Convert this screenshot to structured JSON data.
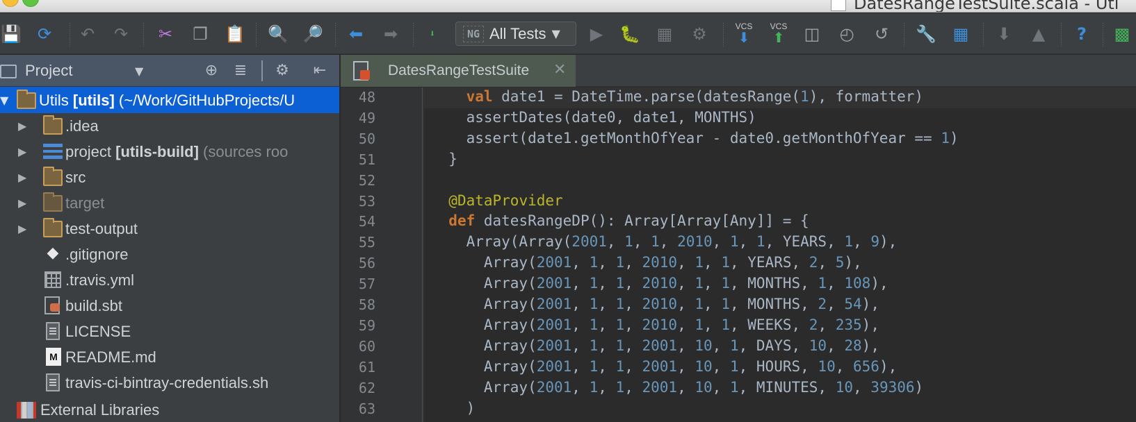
{
  "window": {
    "title": "DatesRangeTestSuite.scala - Uti"
  },
  "toolbar": {
    "run_config": "All Tests",
    "run_config_icon": "NG",
    "vcs_update_label": "VCS",
    "vcs_commit_label": "VCS",
    "icons": [
      "save-icon",
      "sync-icon",
      "undo-icon",
      "redo-icon",
      "cut-icon",
      "copy-icon",
      "paste-icon",
      "find-icon",
      "replace-icon",
      "back-icon",
      "forward-icon",
      "make-icon",
      "run-icon",
      "debug-icon",
      "coverage-icon",
      "profile-icon",
      "vcs-update-icon",
      "vcs-commit-icon",
      "compare-icon",
      "history-icon",
      "revert-icon",
      "settings-icon",
      "structure-icon",
      "sdk-icon",
      "android-icon",
      "help-icon",
      "tool-icon"
    ]
  },
  "project_panel": {
    "title": "Project",
    "items": [
      {
        "label": "Utils",
        "module": "[utils]",
        "path": "(~/Work/GitHubProjects/U",
        "type": "folder",
        "expanded": true,
        "selected": true
      },
      {
        "label": ".idea",
        "type": "folder"
      },
      {
        "label": "project",
        "module": "[utils-build]",
        "hint": "(sources roo",
        "type": "module"
      },
      {
        "label": "src",
        "type": "folder"
      },
      {
        "label": "target",
        "type": "folder-excluded"
      },
      {
        "label": "test-output",
        "type": "folder"
      },
      {
        "label": ".gitignore",
        "type": "git-file"
      },
      {
        "label": ".travis.yml",
        "type": "yml-file"
      },
      {
        "label": "build.sbt",
        "type": "sbt-file"
      },
      {
        "label": "LICENSE",
        "type": "text-file"
      },
      {
        "label": "README.md",
        "type": "md-file"
      },
      {
        "label": "travis-ci-bintray-credentials.sh",
        "type": "text-file"
      },
      {
        "label": "External Libraries",
        "type": "libraries"
      }
    ]
  },
  "editor": {
    "tab_label": "DatesRangeTestSuite",
    "lines": [
      {
        "n": "48",
        "text": "    val date1 = DateTime.parse(datesRange(1), formatter)"
      },
      {
        "n": "49",
        "text": "    assertDates(date0, date1, MONTHS)"
      },
      {
        "n": "50",
        "text": "    assert(date1.getMonthOfYear - date0.getMonthOfYear == 1)"
      },
      {
        "n": "51",
        "text": "  }"
      },
      {
        "n": "52",
        "text": ""
      },
      {
        "n": "53",
        "text": "  @DataProvider"
      },
      {
        "n": "54",
        "text": "  def datesRangeDP(): Array[Array[Any]] = {"
      },
      {
        "n": "55",
        "text": "    Array(Array(2001, 1, 1, 2010, 1, 1, YEARS, 1, 9),"
      },
      {
        "n": "56",
        "text": "      Array(2001, 1, 1, 2010, 1, 1, YEARS, 2, 5),"
      },
      {
        "n": "57",
        "text": "      Array(2001, 1, 1, 2010, 1, 1, MONTHS, 1, 108),"
      },
      {
        "n": "58",
        "text": "      Array(2001, 1, 1, 2010, 1, 1, MONTHS, 2, 54),"
      },
      {
        "n": "59",
        "text": "      Array(2001, 1, 1, 2010, 1, 1, WEEKS, 2, 235),"
      },
      {
        "n": "60",
        "text": "      Array(2001, 1, 1, 2001, 10, 1, DAYS, 10, 28),"
      },
      {
        "n": "61",
        "text": "      Array(2001, 1, 1, 2001, 10, 1, HOURS, 10, 656),"
      },
      {
        "n": "62",
        "text": "      Array(2001, 1, 1, 2001, 10, 1, MINUTES, 10, 39306)"
      },
      {
        "n": "63",
        "text": "    )"
      }
    ]
  },
  "colors": {
    "keyword": "#cc7832",
    "number": "#6897bb",
    "annotation": "#bbb529",
    "text": "#a9b7c6",
    "selection": "#0d5fd4"
  }
}
